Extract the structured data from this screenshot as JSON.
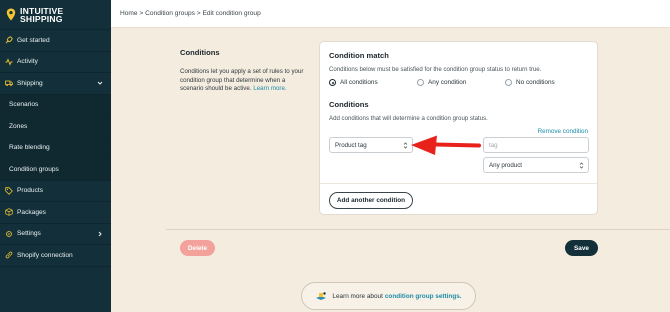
{
  "brand": {
    "line1": "INTUITIVE",
    "line2": "SHIPPING",
    "pin_color": "#f2c531"
  },
  "sidebar": {
    "items": [
      {
        "label": "Get started",
        "icon": "rocket-icon"
      },
      {
        "label": "Activity",
        "icon": "activity-icon"
      },
      {
        "label": "Shipping",
        "icon": "truck-icon",
        "expanded": true
      },
      {
        "label": "Scenarios",
        "sub": true
      },
      {
        "label": "Zones",
        "sub": true
      },
      {
        "label": "Rate blending",
        "sub": true
      },
      {
        "label": "Condition groups",
        "sub": true
      },
      {
        "label": "Products",
        "icon": "tag-icon"
      },
      {
        "label": "Packages",
        "icon": "package-icon"
      },
      {
        "label": "Settings",
        "icon": "gear-icon"
      },
      {
        "label": "Shopify connection",
        "icon": "link-icon"
      }
    ]
  },
  "breadcrumb": {
    "text": "Home > Condition groups > Edit condition group"
  },
  "description": {
    "title": "Conditions",
    "body": "Conditions let you apply a set of rules to your condition group that determine when a scenario should be active.",
    "link": "Learn more."
  },
  "card": {
    "match_title": "Condition match",
    "match_desc": "Conditions below must be satisfied for the condition group status to return true.",
    "radios": [
      {
        "label": "All conditions",
        "checked": true
      },
      {
        "label": "Any condition",
        "checked": false
      },
      {
        "label": "No conditions",
        "checked": false
      }
    ],
    "conditions_title": "Conditions",
    "conditions_desc": "Add conditions that will determine a condition group status.",
    "remove_link": "Remove condition",
    "field_select": "Product tag",
    "tag_placeholder": "tag",
    "product_select": "Any product",
    "add_button": "Add another condition"
  },
  "actions": {
    "delete": "Delete",
    "save": "Save"
  },
  "learn": {
    "prefix": "Learn more about",
    "link": "condition group settings."
  },
  "colors": {
    "sidebar": "#13303a",
    "accent_link": "#1d8ca7",
    "arrow": "#e8221b",
    "delete": "#f2a29b",
    "background": "#f4ecdf"
  }
}
